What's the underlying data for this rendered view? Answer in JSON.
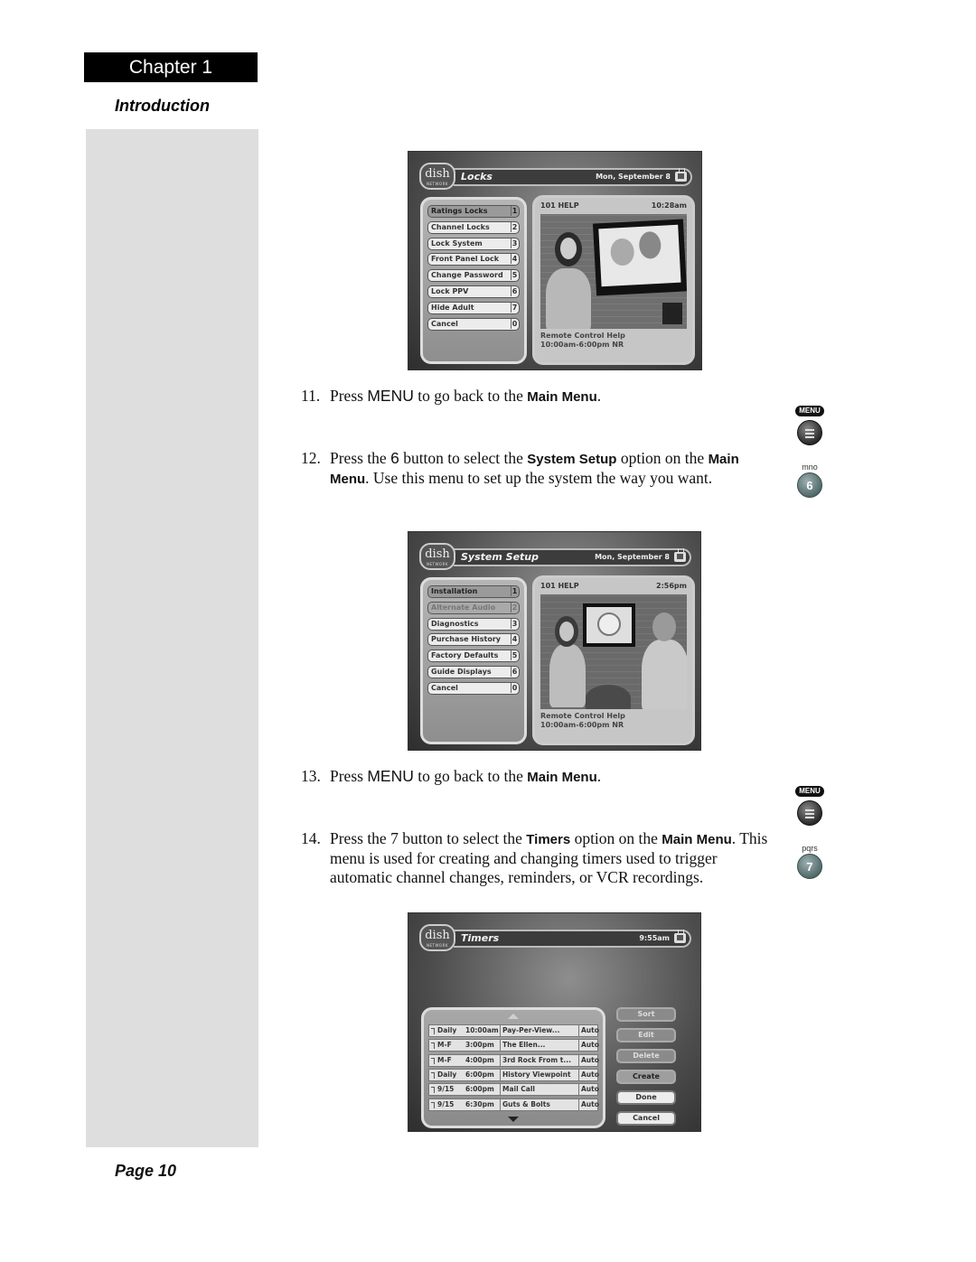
{
  "header": {
    "chapter": "Chapter 1",
    "section": "Introduction"
  },
  "footer": {
    "page": "Page 10"
  },
  "steps": [
    {
      "num": "11.",
      "parts": [
        "Press ",
        "MENU",
        " to go back to the ",
        "Main Menu",
        "."
      ]
    },
    {
      "num": "12.",
      "parts": [
        "Press the ",
        "6",
        " button to select the ",
        "System Setup",
        " option on the ",
        "Main Menu",
        ". Use this menu to set up the system the way you want."
      ]
    },
    {
      "num": "13.",
      "parts": [
        "Press ",
        "MENU",
        " to go back to the ",
        "Main Menu",
        "."
      ]
    },
    {
      "num": "14.",
      "parts": [
        "Press the 7 button to select the ",
        "Timers",
        " option on the ",
        "Main Menu",
        ". This menu is used for creating and changing timers used to trigger automatic channel changes, reminders, or VCR recordings."
      ]
    }
  ],
  "remote_buttons": [
    {
      "label": "MENU",
      "icon": "menu-button-icon"
    },
    {
      "letters": "mno",
      "digit": "6",
      "icon": "number-6-button-icon"
    },
    {
      "label": "MENU",
      "icon": "menu-button-icon"
    },
    {
      "letters": "pqrs",
      "digit": "7",
      "icon": "number-7-button-icon"
    }
  ],
  "screens": {
    "locks": {
      "logo": "dish",
      "logo_sub": "NETWORK",
      "title": "Locks",
      "date": "Mon, September 8",
      "menu": [
        {
          "label": "Ratings Locks",
          "key": "1",
          "state": "selected"
        },
        {
          "label": "Channel Locks",
          "key": "2",
          "state": "normal"
        },
        {
          "label": "Lock System",
          "key": "3",
          "state": "normal"
        },
        {
          "label": "Front Panel Lock",
          "key": "4",
          "state": "normal"
        },
        {
          "label": "Change Password",
          "key": "5",
          "state": "normal"
        },
        {
          "label": "Lock PPV",
          "key": "6",
          "state": "normal"
        },
        {
          "label": "Hide Adult",
          "key": "7",
          "state": "normal"
        },
        {
          "label": "Cancel",
          "key": "0",
          "state": "normal"
        }
      ],
      "help": {
        "channel": "101 HELP",
        "time": "10:28am",
        "line1": "Remote Control Help",
        "line2": "10:00am-6:00pm NR"
      }
    },
    "system_setup": {
      "logo": "dish",
      "logo_sub": "NETWORK",
      "title": "System Setup",
      "date": "Mon, September 8",
      "menu": [
        {
          "label": "Installation",
          "key": "1",
          "state": "selected"
        },
        {
          "label": "Alternate Audio",
          "key": "2",
          "state": "disabled"
        },
        {
          "label": "Diagnostics",
          "key": "3",
          "state": "normal"
        },
        {
          "label": "Purchase History",
          "key": "4",
          "state": "normal"
        },
        {
          "label": "Factory Defaults",
          "key": "5",
          "state": "normal"
        },
        {
          "label": "Guide Displays",
          "key": "6",
          "state": "normal"
        },
        {
          "label": "Cancel",
          "key": "0",
          "state": "normal"
        }
      ],
      "help": {
        "channel": "101 HELP",
        "time": "2:56pm",
        "line1": "Remote Control Help",
        "line2": "10:00am-6:00pm NR"
      }
    },
    "timers": {
      "logo": "dish",
      "logo_sub": "NETWORK",
      "title": "Timers",
      "time": "9:55am",
      "rows": [
        {
          "freq": "Daily",
          "time": "10:00am",
          "program": "Pay-Per-View...",
          "mode": "Auto"
        },
        {
          "freq": "M-F",
          "time": "3:00pm",
          "program": "The Ellen...",
          "mode": "Auto"
        },
        {
          "freq": "M-F",
          "time": "4:00pm",
          "program": "3rd Rock From t...",
          "mode": "Auto"
        },
        {
          "freq": "Daily",
          "time": "6:00pm",
          "program": "History Viewpoint",
          "mode": "Auto"
        },
        {
          "freq": "9/15",
          "time": "6:00pm",
          "program": "Mail Call",
          "mode": "Auto"
        },
        {
          "freq": "9/15",
          "time": "6:30pm",
          "program": "Guts & Bolts",
          "mode": "Auto"
        }
      ],
      "buttons": [
        {
          "label": "Sort",
          "state": "disabled"
        },
        {
          "label": "Edit",
          "state": "disabled"
        },
        {
          "label": "Delete",
          "state": "disabled"
        },
        {
          "label": "Create",
          "state": "active"
        },
        {
          "label": "Done",
          "state": "light"
        },
        {
          "label": "Cancel",
          "state": "light"
        }
      ]
    }
  }
}
